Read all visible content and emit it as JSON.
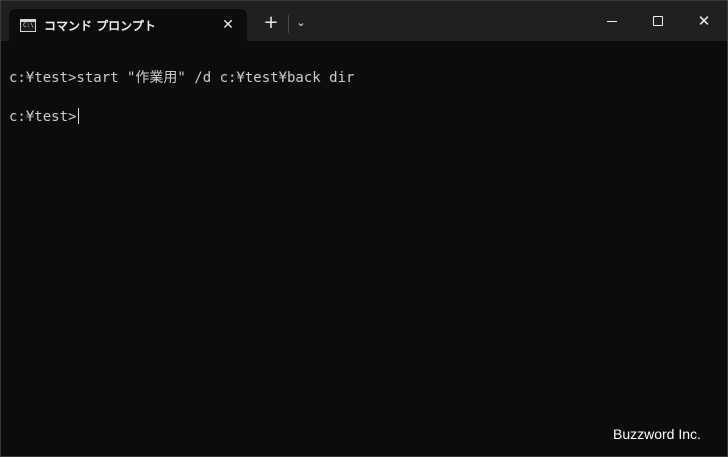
{
  "tab": {
    "icon": "command-prompt-icon",
    "icon_glyph": "C:\\",
    "title": "コマンド プロンプト",
    "close_symbol": "✕"
  },
  "titlebar": {
    "new_tab_symbol": "+",
    "dropdown_symbol": "⌄",
    "minimize_icon": "minimize-icon",
    "maximize_icon": "maximize-icon",
    "close_symbol": "✕"
  },
  "terminal": {
    "lines": [
      "c:¥test>start \"作業用\" /d c:¥test¥back dir",
      "c:¥test>"
    ],
    "background": "#0c0c0c",
    "text_color": "#cccccc"
  },
  "watermark": "Buzzword Inc."
}
